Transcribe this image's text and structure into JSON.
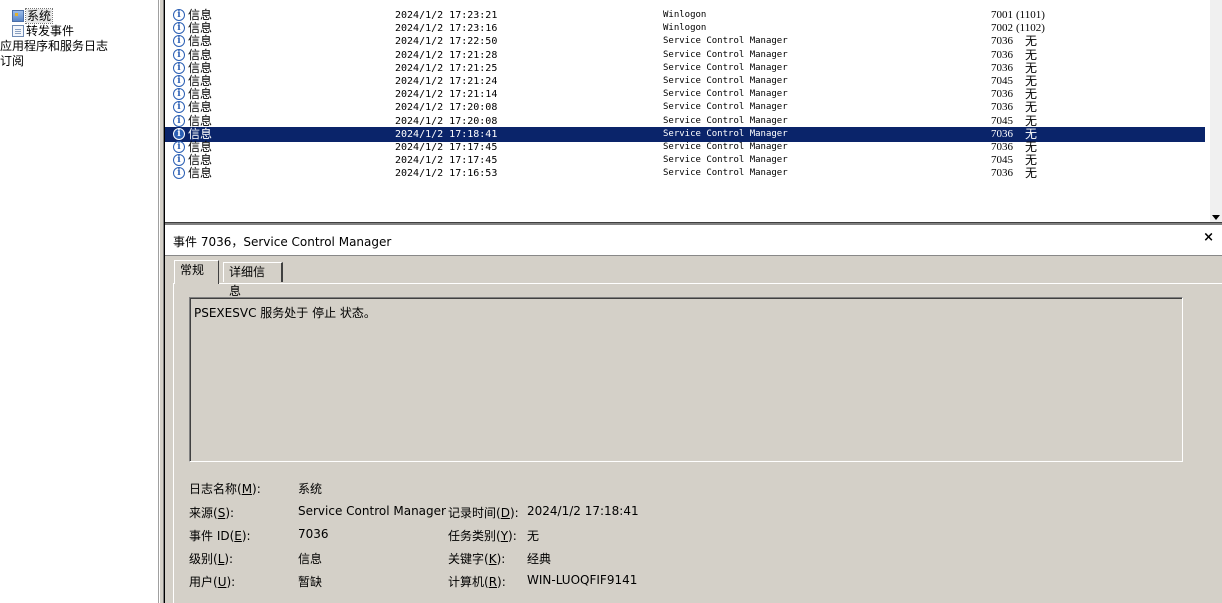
{
  "tree": {
    "system": "系统",
    "forwarded": "转发事件",
    "app_services": "应用程序和服务日志",
    "subscriptions": "订阅"
  },
  "events": [
    {
      "level": "信息",
      "time": "2024/1/2 17:23:21",
      "source": "Winlogon",
      "id": "7001",
      "category": "(1101)"
    },
    {
      "level": "信息",
      "time": "2024/1/2 17:23:16",
      "source": "Winlogon",
      "id": "7002",
      "category": "(1102)"
    },
    {
      "level": "信息",
      "time": "2024/1/2 17:22:50",
      "source": "Service Control Manager",
      "id": "7036",
      "category": "无"
    },
    {
      "level": "信息",
      "time": "2024/1/2 17:21:28",
      "source": "Service Control Manager",
      "id": "7036",
      "category": "无"
    },
    {
      "level": "信息",
      "time": "2024/1/2 17:21:25",
      "source": "Service Control Manager",
      "id": "7036",
      "category": "无"
    },
    {
      "level": "信息",
      "time": "2024/1/2 17:21:24",
      "source": "Service Control Manager",
      "id": "7045",
      "category": "无"
    },
    {
      "level": "信息",
      "time": "2024/1/2 17:21:14",
      "source": "Service Control Manager",
      "id": "7036",
      "category": "无"
    },
    {
      "level": "信息",
      "time": "2024/1/2 17:20:08",
      "source": "Service Control Manager",
      "id": "7036",
      "category": "无"
    },
    {
      "level": "信息",
      "time": "2024/1/2 17:20:08",
      "source": "Service Control Manager",
      "id": "7045",
      "category": "无"
    },
    {
      "level": "信息",
      "time": "2024/1/2 17:18:41",
      "source": "Service Control Manager",
      "id": "7036",
      "category": "无",
      "selected": true
    },
    {
      "level": "信息",
      "time": "2024/1/2 17:17:45",
      "source": "Service Control Manager",
      "id": "7036",
      "category": "无"
    },
    {
      "level": "信息",
      "time": "2024/1/2 17:17:45",
      "source": "Service Control Manager",
      "id": "7045",
      "category": "无"
    },
    {
      "level": "信息",
      "time": "2024/1/2 17:16:53",
      "source": "Service Control Manager",
      "id": "7036",
      "category": "无"
    }
  ],
  "detail": {
    "title": "事件 7036，Service Control Manager",
    "tabs": {
      "general": "常规",
      "details": "详细信息"
    },
    "description": "PSEXESVC 服务处于 停止 状态。",
    "labels": {
      "log_name_a": "日志名称(",
      "log_name_k": "M",
      "log_name_b": "):",
      "source_a": "来源(",
      "source_k": "S",
      "source_b": "):",
      "event_id_a": "事件 ID(",
      "event_id_k": "E",
      "event_id_b": "):",
      "level_a": "级别(",
      "level_k": "L",
      "level_b": "):",
      "user_a": "用户(",
      "user_k": "U",
      "user_b": "):",
      "logged_a": "记录时间(",
      "logged_k": "D",
      "logged_b": "):",
      "task_a": "任务类别(",
      "task_k": "Y",
      "task_b": "):",
      "keywords_a": "关键字(",
      "keywords_k": "K",
      "keywords_b": "):",
      "computer_a": "计算机(",
      "computer_k": "R",
      "computer_b": "):"
    },
    "values": {
      "log_name": "系统",
      "source": "Service Control Manager",
      "event_id": "7036",
      "level": "信息",
      "user": "暂缺",
      "logged": "2024/1/2 17:18:41",
      "task": "无",
      "keywords": "经典",
      "computer": "WIN-LUOQFIF9141"
    }
  }
}
